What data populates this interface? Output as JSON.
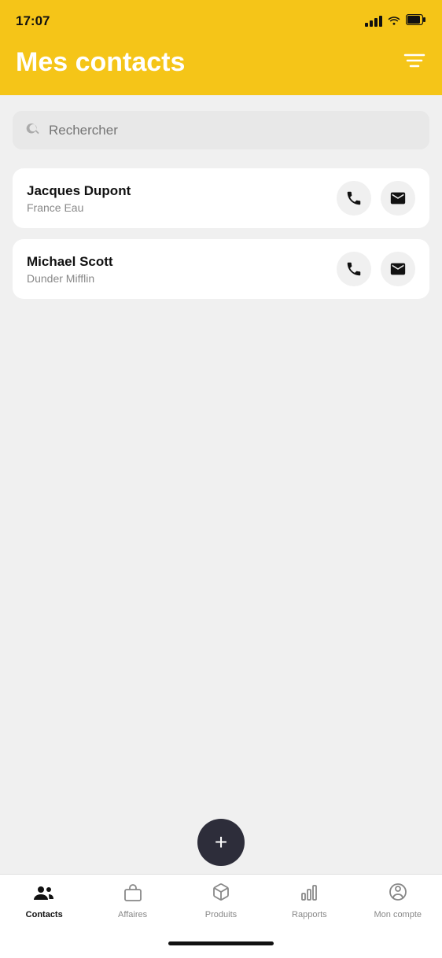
{
  "statusBar": {
    "time": "17:07"
  },
  "header": {
    "title": "Mes contacts",
    "filterLabel": "filter"
  },
  "search": {
    "placeholder": "Rechercher"
  },
  "contacts": [
    {
      "name": "Jacques Dupont",
      "company": "France Eau"
    },
    {
      "name": "Michael Scott",
      "company": "Dunder Mifflin"
    }
  ],
  "fab": {
    "label": "+"
  },
  "bottomNav": {
    "items": [
      {
        "id": "contacts",
        "label": "Contacts",
        "active": true
      },
      {
        "id": "affaires",
        "label": "Affaires",
        "active": false
      },
      {
        "id": "produits",
        "label": "Produits",
        "active": false
      },
      {
        "id": "rapports",
        "label": "Rapports",
        "active": false
      },
      {
        "id": "moncompte",
        "label": "Mon compte",
        "active": false
      }
    ]
  }
}
